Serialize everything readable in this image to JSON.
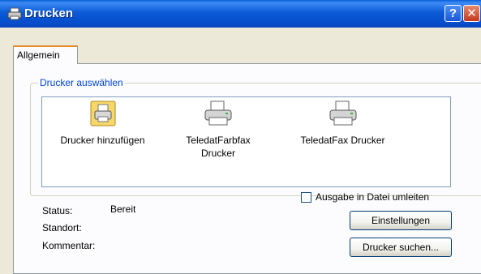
{
  "window": {
    "title": "Drucken"
  },
  "titlebar_buttons": {
    "help": "?",
    "close": "✕"
  },
  "tabs": [
    {
      "label": "Allgemein",
      "active": true
    }
  ],
  "printer_group": {
    "label": "Drucker auswählen",
    "printers": [
      {
        "line1": "Drucker hinzufügen",
        "line2": "",
        "icon": "add-printer-icon"
      },
      {
        "line1": "TeledatFarbfax",
        "line2": "Drucker",
        "icon": "printer-icon"
      },
      {
        "line1": "TeledatFax Drucker",
        "line2": "",
        "icon": "printer-icon"
      }
    ]
  },
  "info": {
    "status_label": "Status:",
    "status_value": "Bereit",
    "location_label": "Standort:",
    "comment_label": "Kommentar:"
  },
  "print_to_file": {
    "label": "Ausgabe in Datei umleiten",
    "checked": false
  },
  "buttons": {
    "settings": "Einstellungen",
    "find_printer": "Drucker suchen..."
  }
}
